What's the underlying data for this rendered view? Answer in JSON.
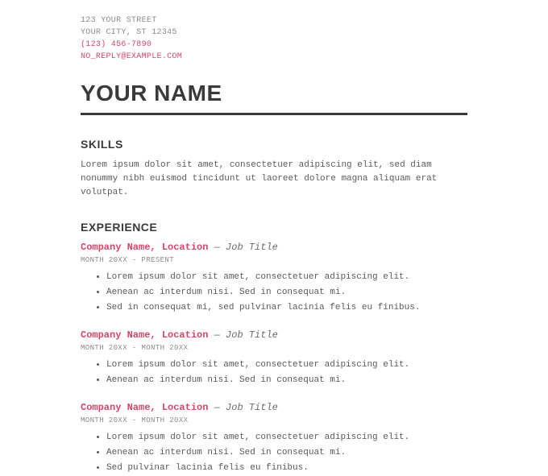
{
  "contact": {
    "street": "123 YOUR STREET",
    "city": "YOUR CITY, ST 12345",
    "phone": "(123) 456-7890",
    "email": "NO_REPLY@EXAMPLE.COM"
  },
  "name": "YOUR NAME",
  "sections": {
    "skills": {
      "title": "SKILLS",
      "body": "Lorem ipsum dolor sit amet, consectetuer adipiscing elit, sed diam nonummy nibh euismod tincidunt ut laoreet dolore magna aliquam erat volutpat."
    },
    "experience": {
      "title": "EXPERIENCE",
      "entries": [
        {
          "company": "Company Name, Location",
          "dash": " — ",
          "title": "Job Title",
          "dates": "MONTH 20XX - PRESENT",
          "bullets": [
            "Lorem ipsum dolor sit amet, consectetuer adipiscing elit.",
            "Aenean ac interdum nisi. Sed in consequat mi.",
            "Sed in consequat mi, sed pulvinar lacinia felis eu finibus."
          ]
        },
        {
          "company": "Company Name, Location",
          "dash": " — ",
          "title": "Job Title",
          "dates": "MONTH 20XX - MONTH 20XX",
          "bullets": [
            "Lorem ipsum dolor sit amet, consectetuer adipiscing elit.",
            "Aenean ac interdum nisi. Sed in consequat mi."
          ]
        },
        {
          "company": "Company Name, Location",
          "dash": " — ",
          "title": "Job Title",
          "dates": "MONTH 20XX - MONTH 20XX",
          "bullets": [
            "Lorem ipsum dolor sit amet, consectetuer adipiscing elit.",
            "Aenean ac interdum nisi. Sed in consequat mi.",
            "Sed pulvinar lacinia felis eu finibus."
          ]
        }
      ]
    }
  }
}
